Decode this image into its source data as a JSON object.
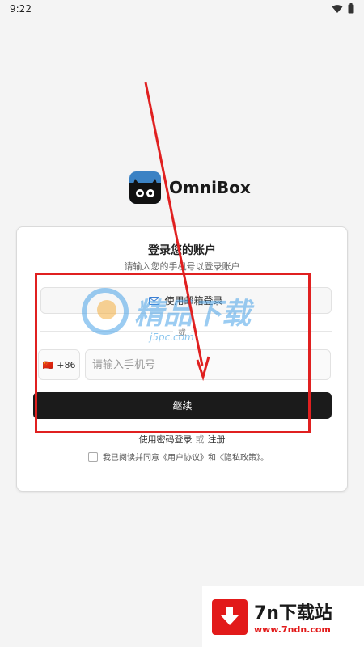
{
  "status_bar": {
    "time": "9:22"
  },
  "brand": {
    "app_name": "OmniBox"
  },
  "login": {
    "title": "登录您的账户",
    "subtitle": "请输入您的手机号以登录账户",
    "email_button_label": "使用邮箱登录",
    "or_text": "或",
    "country_code": "+86",
    "country_flag": "🇨🇳",
    "phone_placeholder": "请输入手机号",
    "phone_value": "",
    "continue_label": "继续",
    "password_login_link": "使用密码登录",
    "or_separator": "或",
    "register_link": "注册",
    "agreement_prefix": "我已阅读并同意",
    "user_agreement_link": "《用户协议》",
    "and_text": "和",
    "privacy_policy_link": "《隐私政策》",
    "agreement_suffix": "。",
    "agreement_checked": false
  },
  "watermark": {
    "text": "精品下载",
    "url": "j5pc.com"
  },
  "site_badge": {
    "title": "7n下载站",
    "url": "www.7ndn.com"
  },
  "colors": {
    "accent_dark": "#1b1b1b",
    "annotation_red": "#e02020",
    "badge_red": "#e21a1a"
  }
}
